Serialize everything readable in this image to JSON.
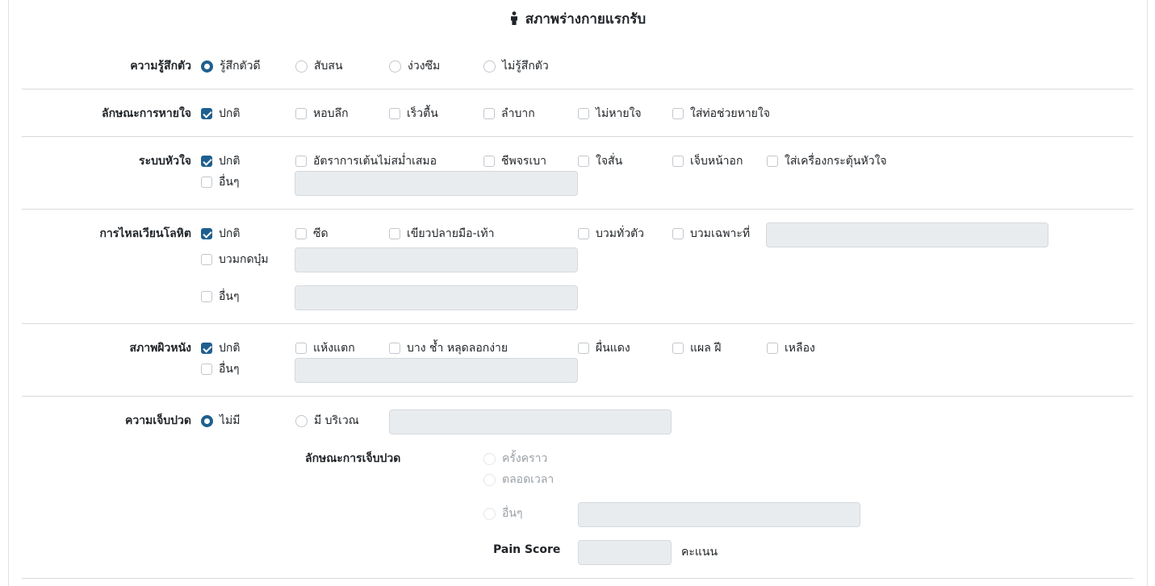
{
  "title": "สภาพร่างกายแรกรับ",
  "consciousness": {
    "label": "ความรู้สึกตัว",
    "options": [
      "รู้สึกตัวดี",
      "สับสน",
      "ง่วงซึม",
      "ไม่รู้สึกตัว"
    ],
    "selected": "รู้สึกตัวดี"
  },
  "breathing": {
    "label": "ลักษณะการหายใจ",
    "options": [
      "ปกติ",
      "หอบลึก",
      "เร็วตื้น",
      "ลำบาก",
      "ไม่หายใจ",
      "ใส่ท่อช่วยหายใจ"
    ],
    "checked": [
      "ปกติ"
    ]
  },
  "cardio": {
    "label": "ระบบหัวใจ",
    "options": [
      "ปกติ",
      "อัตราการเต้นไม่สม่ำเสมอ",
      "ชีพจรเบา",
      "ใจสั่น",
      "เจ็บหน้าอก",
      "ใส่เครื่องกระตุ้นหัวใจ"
    ],
    "other_label": "อื่นๆ",
    "other_value": "",
    "checked": [
      "ปกติ"
    ]
  },
  "circulation": {
    "label": "การไหลเวียนโลหิต",
    "options": [
      "ปกติ",
      "ซีด",
      "เขียวปลายมือ-เท้า",
      "บวมทั่วตัว",
      "บวมเฉพาะที่"
    ],
    "local_edema_value": "",
    "pitting_label": "บวมกดบุ๋ม",
    "pitting_value": "",
    "other_label": "อื่นๆ",
    "other_value": "",
    "checked": [
      "ปกติ"
    ]
  },
  "skin": {
    "label": "สภาพผิวหนัง",
    "options": [
      "ปกติ",
      "แห้งแตก",
      "บาง ช้ำ หลุดลอกง่าย",
      "ผื่นแดง",
      "แผล ฝี",
      "เหลือง"
    ],
    "other_label": "อื่นๆ",
    "other_value": "",
    "checked": [
      "ปกติ"
    ]
  },
  "pain": {
    "label": "ความเจ็บปวด",
    "options": [
      "ไม่มี",
      "มี บริเวณ"
    ],
    "selected": "ไม่มี",
    "area_value": "",
    "character_label": "ลักษณะการเจ็บปวด",
    "character_options": [
      "ครั้งคราว",
      "ตลอดเวลา",
      "อื่นๆ"
    ],
    "character_other_value": "",
    "score_label": "Pain Score",
    "score_value": "",
    "score_unit": "คะแนน"
  }
}
